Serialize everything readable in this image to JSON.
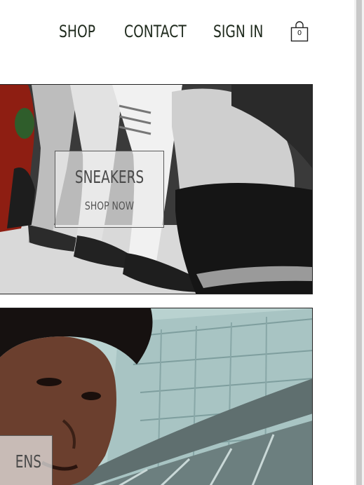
{
  "nav": {
    "items": [
      {
        "label": "SHOP"
      },
      {
        "label": "CONTACT"
      },
      {
        "label": "SIGN IN"
      }
    ],
    "cart_count": "0"
  },
  "banners": [
    {
      "title": "SNEAKERS",
      "cta": "SHOP NOW",
      "image": "sneakers-photo"
    },
    {
      "title": "ENS",
      "image": "mens-photo"
    }
  ],
  "colors": {
    "nav_text": "#1f2a1d",
    "box_bg": "#ebebeb",
    "box_text": "#4a4a4a"
  }
}
